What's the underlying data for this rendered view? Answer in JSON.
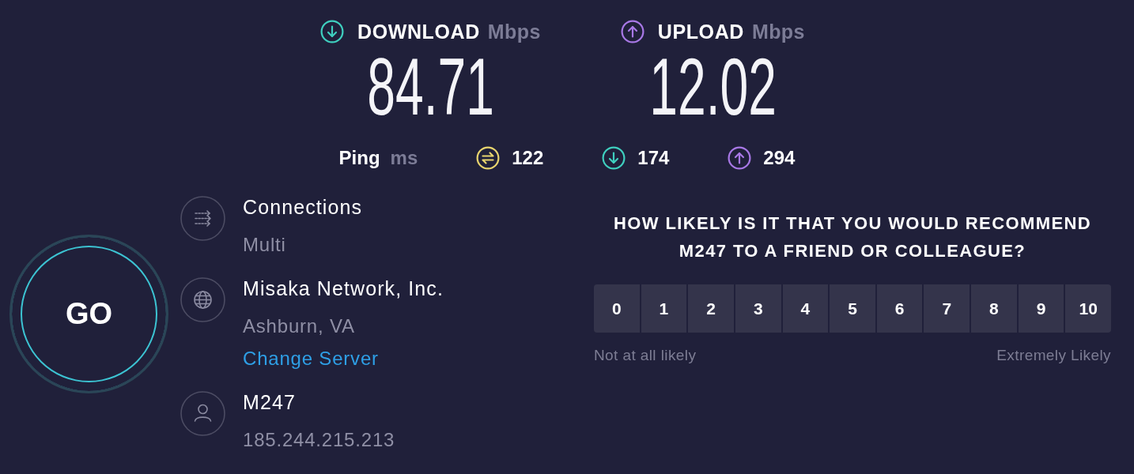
{
  "metrics": [
    {
      "kind": "download",
      "label": "DOWNLOAD",
      "unit": "Mbps",
      "value": "84.71"
    },
    {
      "kind": "upload",
      "label": "UPLOAD",
      "unit": "Mbps",
      "value": "12.02"
    }
  ],
  "ping": {
    "label": "Ping",
    "unit": "ms",
    "readings": [
      {
        "kind": "idle",
        "value": "122"
      },
      {
        "kind": "download",
        "value": "174"
      },
      {
        "kind": "upload",
        "value": "294"
      }
    ]
  },
  "go_button": {
    "label": "GO"
  },
  "info": [
    {
      "kind": "connections",
      "title": "Connections",
      "lines": [
        {
          "kind": "detail",
          "text": "Multi"
        }
      ]
    },
    {
      "kind": "server",
      "title": "Misaka Network, Inc.",
      "lines": [
        {
          "kind": "detail",
          "text": "Ashburn, VA"
        },
        {
          "kind": "link",
          "text": "Change Server"
        }
      ]
    },
    {
      "kind": "provider",
      "title": "M247",
      "lines": [
        {
          "kind": "detail",
          "text": "185.244.215.213"
        }
      ]
    }
  ],
  "survey": {
    "question": "HOW LIKELY IS IT THAT YOU WOULD RECOMMEND M247 TO A FRIEND OR COLLEAGUE?",
    "scale": [
      {
        "label": "0",
        "selected": false
      },
      {
        "label": "1",
        "selected": false
      },
      {
        "label": "2",
        "selected": false
      },
      {
        "label": "3",
        "selected": false
      },
      {
        "label": "4",
        "selected": false
      },
      {
        "label": "5",
        "selected": false
      },
      {
        "label": "6",
        "selected": false
      },
      {
        "label": "7",
        "selected": false
      },
      {
        "label": "8",
        "selected": false
      },
      {
        "label": "9",
        "selected": false
      },
      {
        "label": "10",
        "selected": false
      }
    ],
    "low_label": "Not at all likely",
    "high_label": "Extremely Likely"
  }
}
